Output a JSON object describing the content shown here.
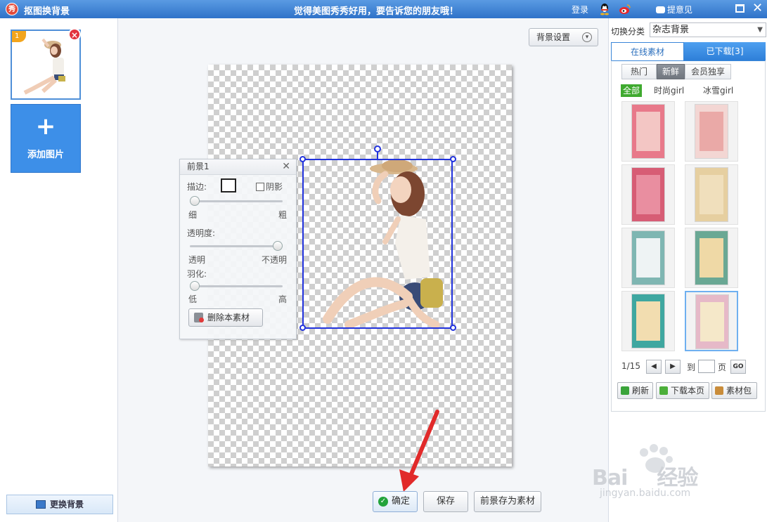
{
  "titlebar": {
    "app_icon_text": "秀",
    "title": "抠图换背景",
    "slogan": "觉得美图秀秀好用，要告诉您的朋友哦！",
    "login": "登录",
    "feedback": "提意见",
    "icons": [
      "qq-icon",
      "weibo-icon",
      "maximize-icon",
      "close-icon"
    ]
  },
  "left": {
    "thumb_number": "1",
    "add_plus": "+",
    "add_label": "添加图片",
    "change_bg_label": "更换背景"
  },
  "center": {
    "bg_settings_label": "背景设置",
    "foreground_panel": {
      "title": "前景1",
      "stroke_label": "描边:",
      "shadow_label": "阴影",
      "thin_label": "细",
      "thick_label": "粗",
      "opacity_label": "透明度:",
      "transparent_label": "透明",
      "opaque_label": "不透明",
      "feather_label": "羽化:",
      "low_label": "低",
      "high_label": "高",
      "delete_label": "删除本素材",
      "stroke_level": 0,
      "opacity_level": 1,
      "feather_level": 0
    },
    "buttons": {
      "ok": "确定",
      "save": "保存",
      "save_as_material": "前景存为素材"
    }
  },
  "right": {
    "switch_category_label": "切换分类",
    "category_value": "杂志背景",
    "tab_online": "在线素材",
    "tab_downloaded": "已下载[3]",
    "segments": [
      "热门",
      "新鲜",
      "会员独享"
    ],
    "active_segment": "新鲜",
    "filters": [
      "全部",
      "时尚girl",
      "冰雪girl"
    ],
    "active_filter": "全部",
    "pager": {
      "current": "1/15",
      "to_label": "到",
      "page_label": "页",
      "go_label": "GO"
    },
    "actions": {
      "refresh": "刷新",
      "download_page": "下载本页",
      "material_pack": "素材包"
    },
    "colors": {
      "accent_blue": "#3a86d8",
      "filter_green": "#3faa2f"
    }
  },
  "watermark": {
    "brand": "Bai",
    "brand_cn": "经验",
    "url": "jingyan.baidu.com"
  }
}
